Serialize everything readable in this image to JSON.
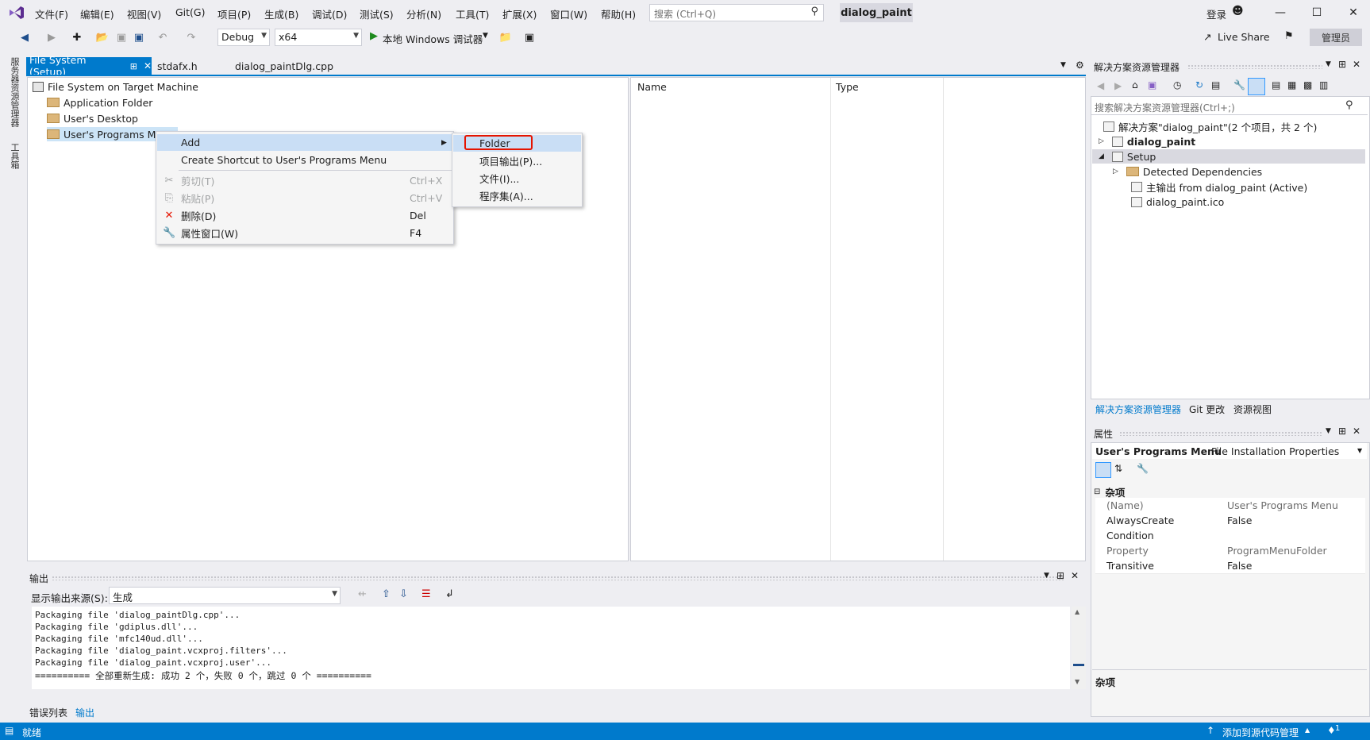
{
  "menu": [
    "文件(F)",
    "编辑(E)",
    "视图(V)",
    "Git(G)",
    "项目(P)",
    "生成(B)",
    "调试(D)",
    "测试(S)",
    "分析(N)",
    "工具(T)",
    "扩展(X)",
    "窗口(W)",
    "帮助(H)"
  ],
  "search": {
    "placeholder": "搜索 (Ctrl+Q)"
  },
  "project_title": "dialog_paint",
  "login": "登录",
  "toolbar": {
    "config": "Debug",
    "platform": "x64",
    "run_label": "本地 Windows 调试器",
    "live_share": "Live Share",
    "admin": "管理员"
  },
  "left_strip": [
    "服务器资源管理器",
    "工具箱"
  ],
  "tabs": [
    {
      "label": "File System (Setup)",
      "active": true
    },
    {
      "label": "stdafx.h",
      "active": false
    },
    {
      "label": "dialog_paintDlg.cpp",
      "active": false
    }
  ],
  "tree": {
    "root": "File System on Target Machine",
    "items": [
      "Application Folder",
      "User's Desktop",
      "User's Programs Me"
    ]
  },
  "list_columns": [
    "Name",
    "Type"
  ],
  "context_menu": {
    "items": [
      {
        "label": "Add",
        "shortcut": "",
        "icon": "",
        "disabled": false,
        "highlight": true
      },
      {
        "label": "Create Shortcut to User's Programs Menu",
        "shortcut": "",
        "icon": "",
        "disabled": false,
        "highlight": false
      },
      {
        "label": "剪切(T)",
        "shortcut": "Ctrl+X",
        "icon": "scissors-icon",
        "disabled": true,
        "highlight": false
      },
      {
        "label": "粘贴(P)",
        "shortcut": "Ctrl+V",
        "icon": "paste-icon",
        "disabled": true,
        "highlight": false
      },
      {
        "label": "删除(D)",
        "shortcut": "Del",
        "icon": "delete-icon",
        "disabled": false,
        "highlight": false
      },
      {
        "label": "属性窗口(W)",
        "shortcut": "F4",
        "icon": "wrench-icon",
        "disabled": false,
        "highlight": false
      }
    ],
    "submenu": [
      "Folder",
      "项目输出(P)...",
      "文件(I)...",
      "程序集(A)..."
    ]
  },
  "solution_explorer": {
    "title": "解决方案资源管理器",
    "search_placeholder": "搜索解决方案资源管理器(Ctrl+;)",
    "items": [
      "解决方案\"dialog_paint\"(2 个项目，共 2 个)",
      "dialog_paint",
      "Setup",
      "Detected Dependencies",
      "主输出 from dialog_paint (Active)",
      "dialog_paint.ico"
    ],
    "bottom_tabs": [
      "解决方案资源管理器",
      "Git 更改",
      "资源视图"
    ]
  },
  "properties": {
    "title": "属性",
    "object_name": "User's Programs Menu",
    "object_type": "File Installation Properties",
    "category": "杂项",
    "rows": [
      {
        "key": "(Name)",
        "value": "User's Programs Menu",
        "gray": true
      },
      {
        "key": "AlwaysCreate",
        "value": "False",
        "gray": false
      },
      {
        "key": "Condition",
        "value": "",
        "gray": false
      },
      {
        "key": "Property",
        "value": "ProgramMenuFolder",
        "gray": true
      },
      {
        "key": "Transitive",
        "value": "False",
        "gray": false
      }
    ],
    "description_title": "杂项"
  },
  "output": {
    "title": "输出",
    "source_label": "显示输出来源(S):",
    "source_value": "生成",
    "lines": [
      "Packaging file 'dialog_paintDlg.cpp'...",
      "Packaging file 'gdiplus.dll'...",
      "Packaging file 'mfc140ud.dll'...",
      "Packaging file 'dialog_paint.vcxproj.filters'...",
      "Packaging file 'dialog_paint.vcxproj.user'...",
      "========== 全部重新生成: 成功 2 个，失败 0 个，跳过 0 个 =========="
    ],
    "bottom_tabs": [
      "错误列表",
      "输出"
    ]
  },
  "status": {
    "left": "就绪",
    "right": "添加到源代码管理",
    "notifications": "1"
  },
  "colors": {
    "accent": "#007acc",
    "highlight_box": "#e51400"
  }
}
